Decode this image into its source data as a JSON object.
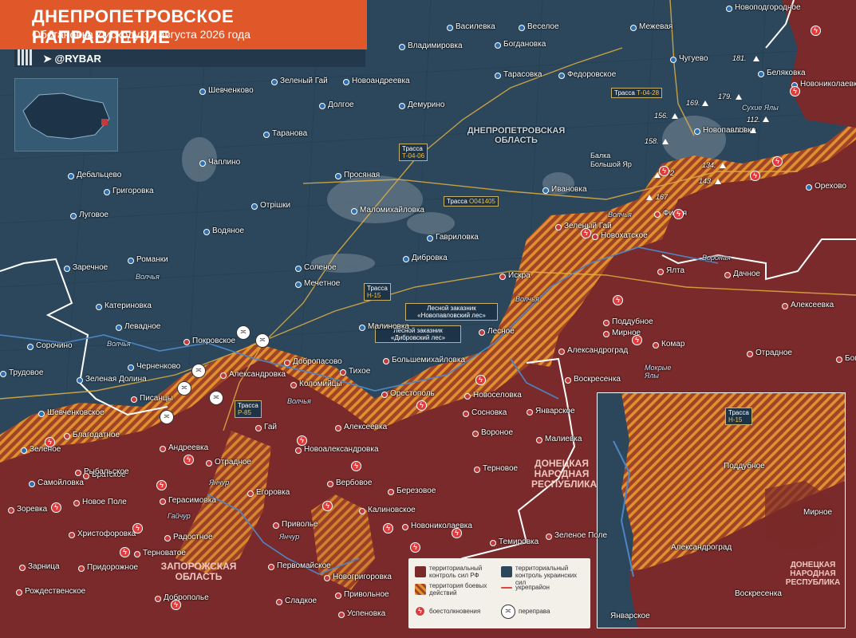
{
  "title": "ДНЕПРОПЕТРОВСКОЕ НАПРАВЛЕНИЕ",
  "subtitle": "Обстановка к исходу 31 августа 2026 года",
  "brand": "@RYBAR",
  "colors": {
    "ua_control": "#2a4459",
    "ru_control": "#7a2a2a",
    "combat": "#e08a2a",
    "accent": "#e0582a"
  },
  "icons": [
    "qr-icon",
    "telegram-icon",
    "clash-icon",
    "crossing-icon",
    "height-marker-icon"
  ],
  "regions": {
    "dnipro_oblast": "ДНЕПРОПЕТРОВСКАЯ ОБЛАСТЬ",
    "zaporozhye_oblast": "ЗАПОРОЖСКАЯ ОБЛАСТЬ",
    "dnr": "ДОНЕЦКАЯ НАРОДНАЯ РЕСПУБЛИКА",
    "balka": "Балка Большой Яр",
    "forest1": "Лесной заказник «Новопавловский лес»",
    "forest2": "Лесной заказник «Дибровский лес»"
  },
  "roads": {
    "t0428": {
      "prefix": "Трасса ",
      "code": "Т-04-28"
    },
    "t0406": {
      "prefix": "Трасса",
      "code": "Т-04-06"
    },
    "o041405": {
      "prefix": "Трасса ",
      "code": "О041405"
    },
    "h15": {
      "prefix": "Трасса",
      "code": "Н-15"
    },
    "p85": {
      "prefix": "Трасса",
      "code": "Р-85"
    },
    "inset_h15": {
      "prefix": "Трасса",
      "code": "Н-15"
    }
  },
  "rivers": [
    "Волчья",
    "Волчья",
    "Волчья",
    "Волчья",
    "Волчья",
    "Вороная",
    "Гайчур",
    "Янчур",
    "Янчур",
    "Мокрые Ялы",
    "Сухие Ялы"
  ],
  "heights": [
    "181.",
    "179.",
    "169.",
    "156.",
    "112.",
    "113.",
    "158.",
    "172",
    "134.",
    "143.",
    "167"
  ],
  "ua_towns": [
    "Василевка",
    "Веселое",
    "Межевая",
    "Новоподгородное",
    "Богдановка",
    "Владимировка",
    "Тарасовка",
    "Федоровское",
    "Чугуево",
    "Беляковка",
    "Новониколаевка",
    "Шевченково",
    "Зеленый Гай",
    "Новоандреевка",
    "Долгое",
    "Демурино",
    "Таранова",
    "Дебальцево",
    "Чаплино",
    "Просяная",
    "Григоровка",
    "Луговое",
    "Отрішки",
    "Водяное",
    "Маломихайловка",
    "Ивановка",
    "Гавриловка",
    "Романки",
    "Заречное",
    "Соленое",
    "Мечетное",
    "Дибровка",
    "Катериновка",
    "Левадное",
    "Сорочино",
    "Малиновка",
    "Трудовое",
    "Черненково",
    "Зеленая Долина",
    "Шевченковское",
    "Зеленое",
    "Самойловка",
    "Новопавловка",
    "Орехово"
  ],
  "ru_towns": [
    "Покровское",
    "Александровка",
    "Добропасово",
    "Тихое",
    "Большемихайловка",
    "Лесное",
    "Искра",
    "Зеленый Гай",
    "Новохатское",
    "Филия",
    "Ялта",
    "Дачное",
    "Поддубное",
    "Мирное",
    "Александроград",
    "Комар",
    "Воскресенка",
    "Отрадное",
    "Богатырь",
    "Алексеевка",
    "Коломийцы",
    "Писанцы",
    "Орестополь",
    "Новоселовка",
    "Сосновка",
    "Январское",
    "Вороное",
    "Малиевка",
    "Благодатное",
    "Андреевка",
    "Гай",
    "Новоалександровка",
    "Алексеевка",
    "Братское",
    "Рыбальское",
    "Отрадное",
    "Вербовое",
    "Березовое",
    "Терновое",
    "Новое Поле",
    "Герасимовка",
    "Егоровка",
    "Калиновское",
    "Зоревка",
    "Христофоровка",
    "Радостное",
    "Приволье",
    "Новониколаевка",
    "Темировка",
    "Зеленое Поле",
    "Зарница",
    "Терноватое",
    "Придорожное",
    "Первомайское",
    "Новогригоровка",
    "Рождественское",
    "Привольное",
    "Доброполье",
    "Сладкое",
    "Успеновка"
  ],
  "inset": {
    "towns": [
      "Поддубное",
      "Мирное",
      "Александроград",
      "Воскресенка",
      "Январское"
    ],
    "region": "ДОНЕЦКАЯ НАРОДНАЯ РЕСПУБЛИКА"
  },
  "legend": {
    "ru": "территориальный контроль сил РФ",
    "ua": "территориальный контроль украинских сил",
    "combat": "территория боевых действий",
    "fort": "укрепрайон",
    "clash": "боестолкновения",
    "crossing": "переправа"
  }
}
